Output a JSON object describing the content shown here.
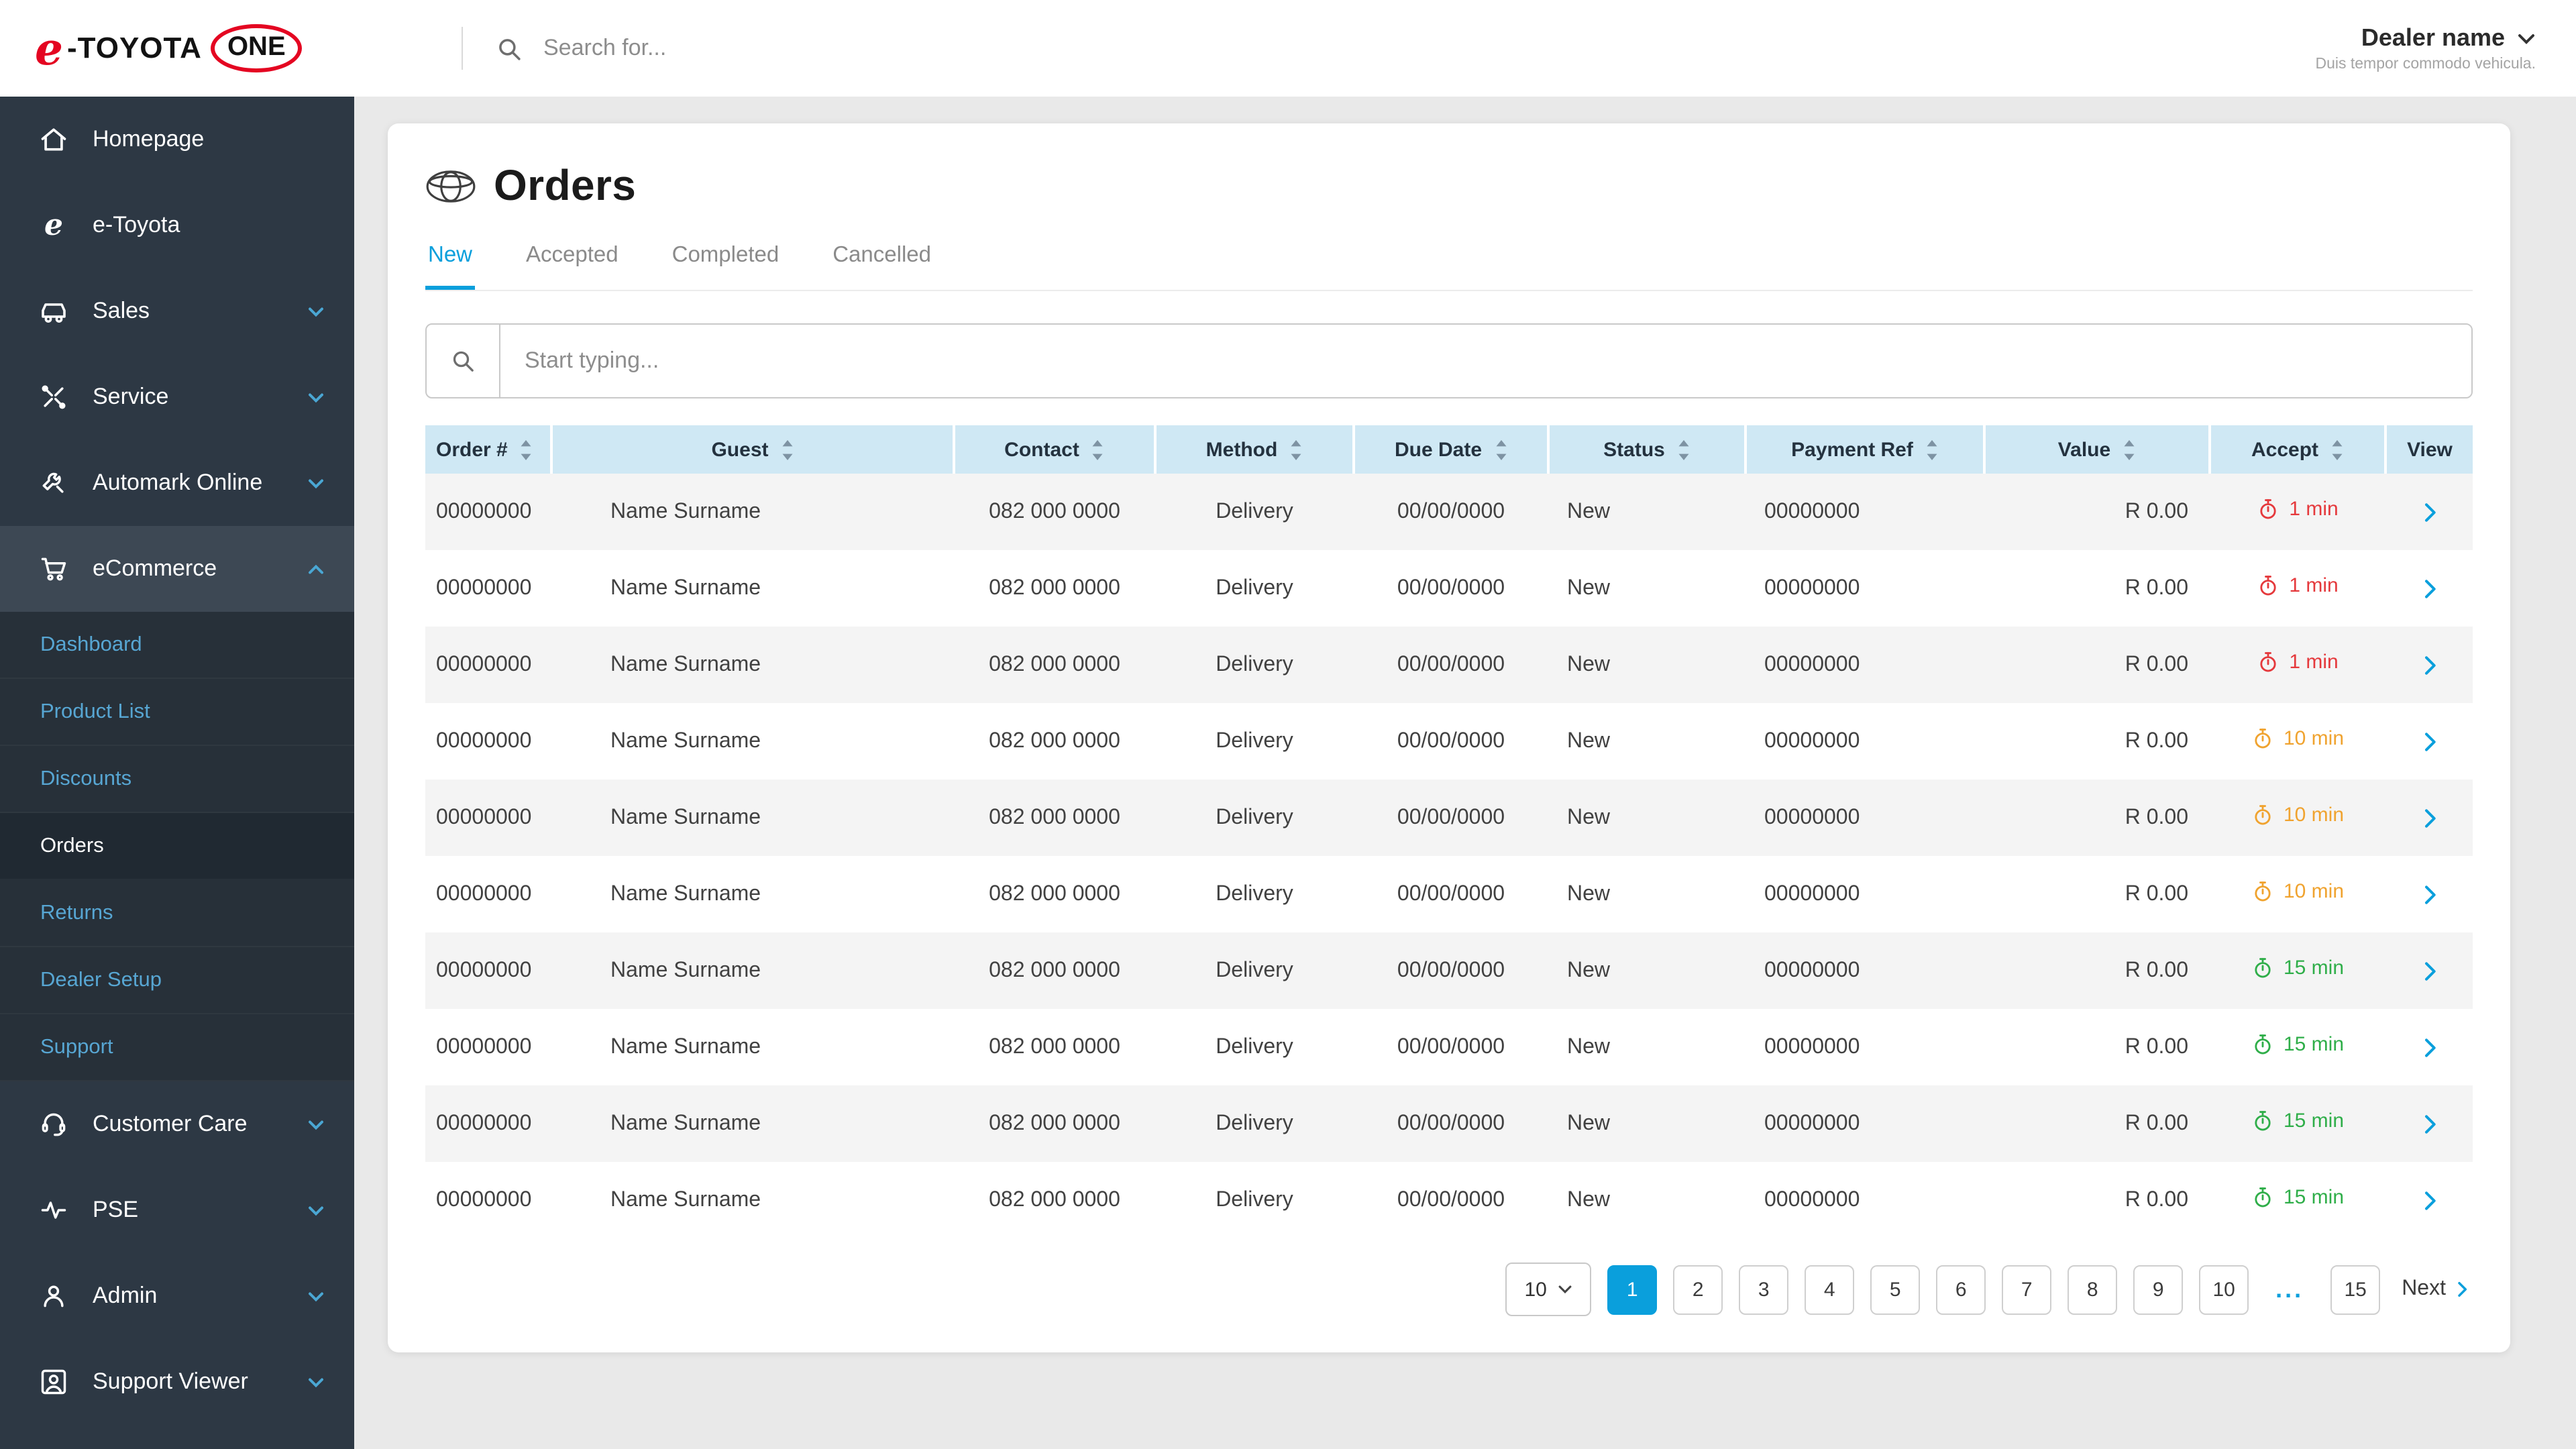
{
  "colors": {
    "accent_blue": "#0a9fdc",
    "toyota_red": "#e40521",
    "accept_red": "#e5393c",
    "accept_amber": "#f0a32f",
    "accept_green": "#2fae49",
    "sidebar_bg": "#2d3844",
    "table_header_bg": "#cfe8f4"
  },
  "header": {
    "logo": {
      "e": "e",
      "dash_toyota": "-TOYOTA",
      "one": "ONE"
    },
    "search_placeholder": "Search for...",
    "dealer_name": "Dealer name",
    "dealer_subtitle": "Duis tempor commodo vehicula."
  },
  "sidebar": {
    "items": [
      {
        "label": "Homepage"
      },
      {
        "label": "e-Toyota"
      },
      {
        "label": "Sales",
        "expandable": true
      },
      {
        "label": "Service",
        "expandable": true
      },
      {
        "label": "Automark Online",
        "expandable": true
      },
      {
        "label": "eCommerce",
        "expandable": true,
        "expanded": true
      }
    ],
    "ecommerce_children": [
      {
        "label": "Dashboard"
      },
      {
        "label": "Product List"
      },
      {
        "label": "Discounts"
      },
      {
        "label": "Orders",
        "active": true
      },
      {
        "label": "Returns"
      },
      {
        "label": "Dealer Setup"
      },
      {
        "label": "Support"
      }
    ],
    "bottom_items": [
      {
        "label": "Customer Care",
        "expandable": true
      },
      {
        "label": "PSE",
        "expandable": true
      },
      {
        "label": "Admin",
        "expandable": true
      },
      {
        "label": "Support Viewer",
        "expandable": true
      }
    ]
  },
  "main": {
    "title": "Orders",
    "tabs": [
      {
        "label": "New",
        "active": true
      },
      {
        "label": "Accepted"
      },
      {
        "label": "Completed"
      },
      {
        "label": "Cancelled"
      }
    ],
    "filter_placeholder": "Start typing...",
    "table": {
      "columns": [
        "Order #",
        "Guest",
        "Contact",
        "Method",
        "Due Date",
        "Status",
        "Payment Ref",
        "Value",
        "Accept",
        "View"
      ],
      "rows": [
        {
          "order": "00000000",
          "guest": "Name Surname",
          "contact": "082 000 0000",
          "method": "Delivery",
          "due_date": "00/00/0000",
          "status": "New",
          "payment_ref": "00000000",
          "value": "R 0.00",
          "accept": {
            "label": "1 min",
            "color": "red"
          }
        },
        {
          "order": "00000000",
          "guest": "Name Surname",
          "contact": "082 000 0000",
          "method": "Delivery",
          "due_date": "00/00/0000",
          "status": "New",
          "payment_ref": "00000000",
          "value": "R 0.00",
          "accept": {
            "label": "1 min",
            "color": "red"
          }
        },
        {
          "order": "00000000",
          "guest": "Name Surname",
          "contact": "082 000 0000",
          "method": "Delivery",
          "due_date": "00/00/0000",
          "status": "New",
          "payment_ref": "00000000",
          "value": "R 0.00",
          "accept": {
            "label": "1 min",
            "color": "red"
          }
        },
        {
          "order": "00000000",
          "guest": "Name Surname",
          "contact": "082 000 0000",
          "method": "Delivery",
          "due_date": "00/00/0000",
          "status": "New",
          "payment_ref": "00000000",
          "value": "R 0.00",
          "accept": {
            "label": "10 min",
            "color": "amber"
          }
        },
        {
          "order": "00000000",
          "guest": "Name Surname",
          "contact": "082 000 0000",
          "method": "Delivery",
          "due_date": "00/00/0000",
          "status": "New",
          "payment_ref": "00000000",
          "value": "R 0.00",
          "accept": {
            "label": "10 min",
            "color": "amber"
          }
        },
        {
          "order": "00000000",
          "guest": "Name Surname",
          "contact": "082 000 0000",
          "method": "Delivery",
          "due_date": "00/00/0000",
          "status": "New",
          "payment_ref": "00000000",
          "value": "R 0.00",
          "accept": {
            "label": "10 min",
            "color": "amber"
          }
        },
        {
          "order": "00000000",
          "guest": "Name Surname",
          "contact": "082 000 0000",
          "method": "Delivery",
          "due_date": "00/00/0000",
          "status": "New",
          "payment_ref": "00000000",
          "value": "R 0.00",
          "accept": {
            "label": "15 min",
            "color": "green"
          }
        },
        {
          "order": "00000000",
          "guest": "Name Surname",
          "contact": "082 000 0000",
          "method": "Delivery",
          "due_date": "00/00/0000",
          "status": "New",
          "payment_ref": "00000000",
          "value": "R 0.00",
          "accept": {
            "label": "15 min",
            "color": "green"
          }
        },
        {
          "order": "00000000",
          "guest": "Name Surname",
          "contact": "082 000 0000",
          "method": "Delivery",
          "due_date": "00/00/0000",
          "status": "New",
          "payment_ref": "00000000",
          "value": "R 0.00",
          "accept": {
            "label": "15 min",
            "color": "green"
          }
        },
        {
          "order": "00000000",
          "guest": "Name Surname",
          "contact": "082 000 0000",
          "method": "Delivery",
          "due_date": "00/00/0000",
          "status": "New",
          "payment_ref": "00000000",
          "value": "R 0.00",
          "accept": {
            "label": "15 min",
            "color": "green"
          }
        }
      ]
    },
    "pagination": {
      "page_size": "10",
      "pages": [
        "1",
        "2",
        "3",
        "4",
        "5",
        "6",
        "7",
        "8",
        "9",
        "10"
      ],
      "active_page": "1",
      "ellipsis": "...",
      "last_page": "15",
      "next_label": "Next"
    }
  }
}
